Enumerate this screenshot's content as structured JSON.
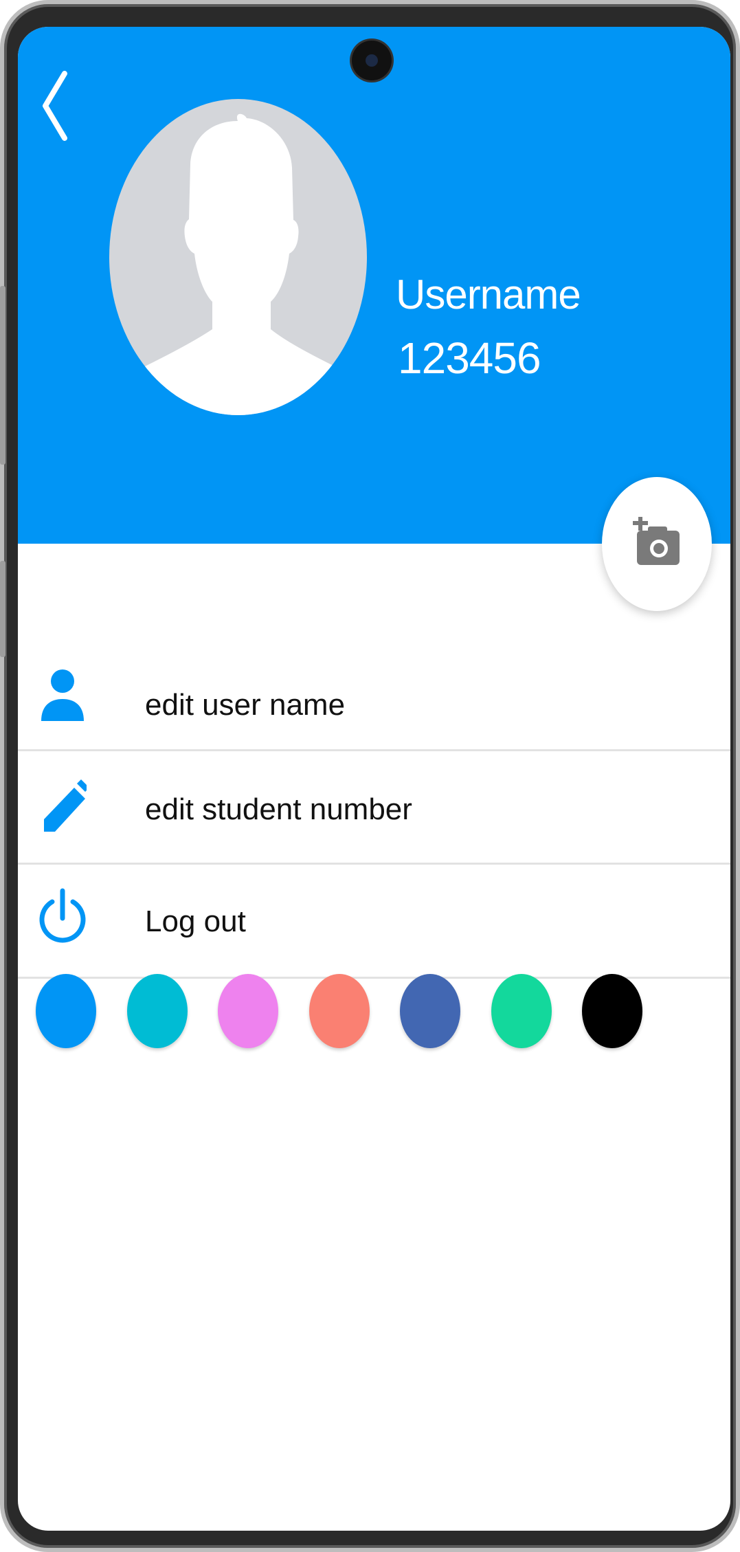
{
  "header": {
    "background_color": "#0195f5",
    "back_icon": "chevron-left-icon",
    "username": "Username",
    "student_number": "123456",
    "camera_button_icon": "add-photo-icon"
  },
  "menu": {
    "items": [
      {
        "label": "edit user name",
        "icon": "person-icon"
      },
      {
        "label": "edit student number",
        "icon": "pencil-icon"
      },
      {
        "label": "Log out",
        "icon": "power-icon"
      }
    ],
    "icon_color": "#0195f5"
  },
  "theme_colors": [
    {
      "name": "blue",
      "color": "#0195f5"
    },
    {
      "name": "cyan",
      "color": "#00bcd4"
    },
    {
      "name": "violet",
      "color": "#ee82ee"
    },
    {
      "name": "salmon",
      "color": "#fa8072"
    },
    {
      "name": "indigo",
      "color": "#4267b2"
    },
    {
      "name": "green",
      "color": "#13d89c"
    },
    {
      "name": "black",
      "color": "#000000"
    }
  ]
}
